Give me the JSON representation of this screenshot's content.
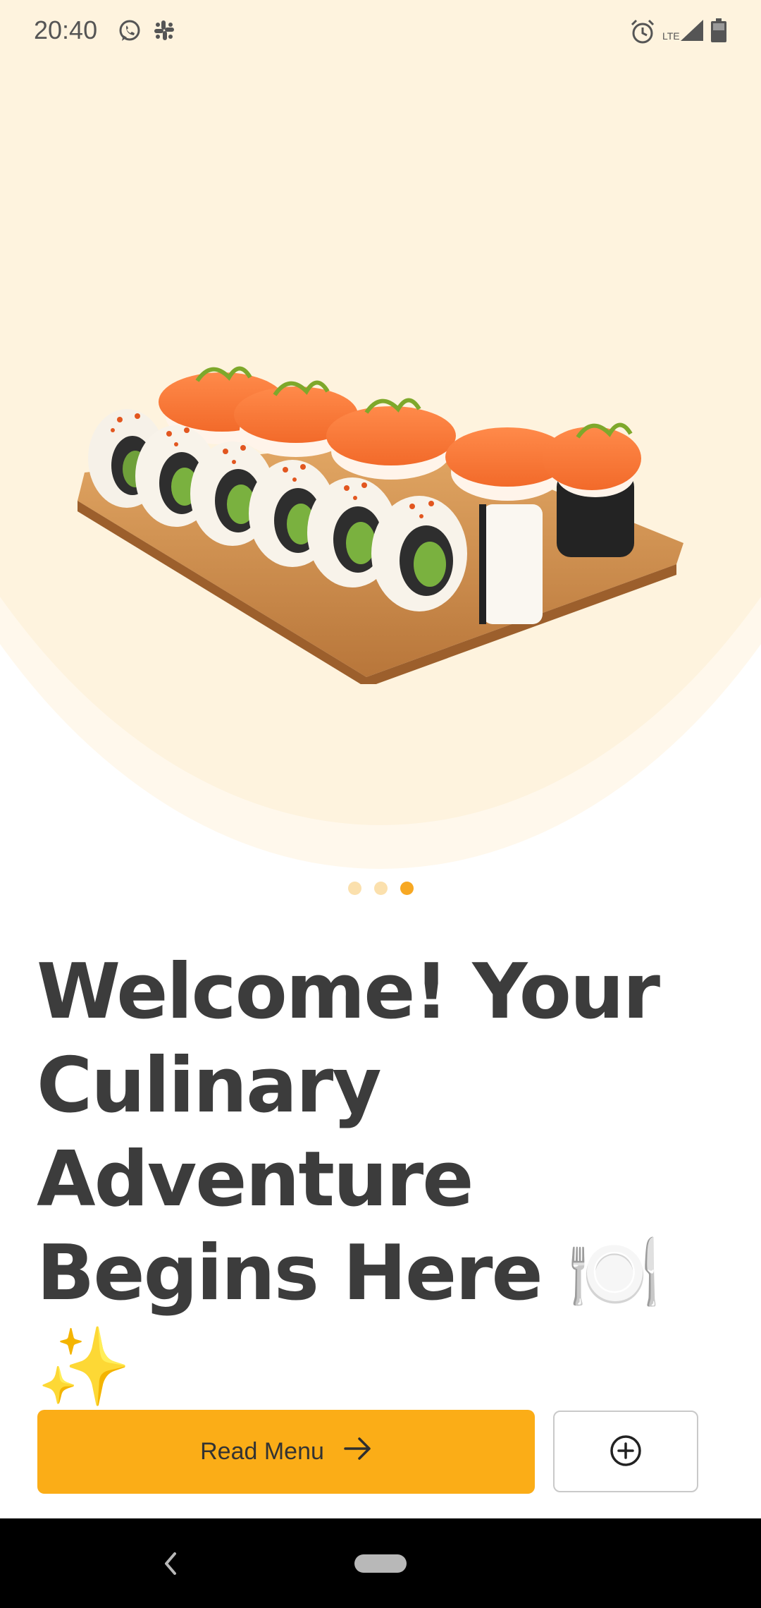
{
  "status_bar": {
    "time": "20:40",
    "network_label": "LTE",
    "icons": [
      "whatsapp-icon",
      "slack-icon",
      "alarm-icon",
      "signal-icon",
      "battery-icon"
    ]
  },
  "carousel": {
    "page_count": 3,
    "active_index": 2
  },
  "headline": "Welcome! Your Culinary Adventure Begins Here 🍽️✨",
  "primary_button": {
    "label": "Read Menu",
    "icon": "arrow-right-icon"
  },
  "secondary_button": {
    "icon": "plus-circle-icon"
  },
  "navigation": {
    "back_icon": "back-chevron-icon",
    "home_icon": "home-pill-icon"
  },
  "colors": {
    "hero_background": "#fef3de",
    "accent": "#fbad17",
    "dot_active": "#f7a823",
    "dot_inactive": "#fbe0ad",
    "headline_text": "#3c3c3c"
  }
}
